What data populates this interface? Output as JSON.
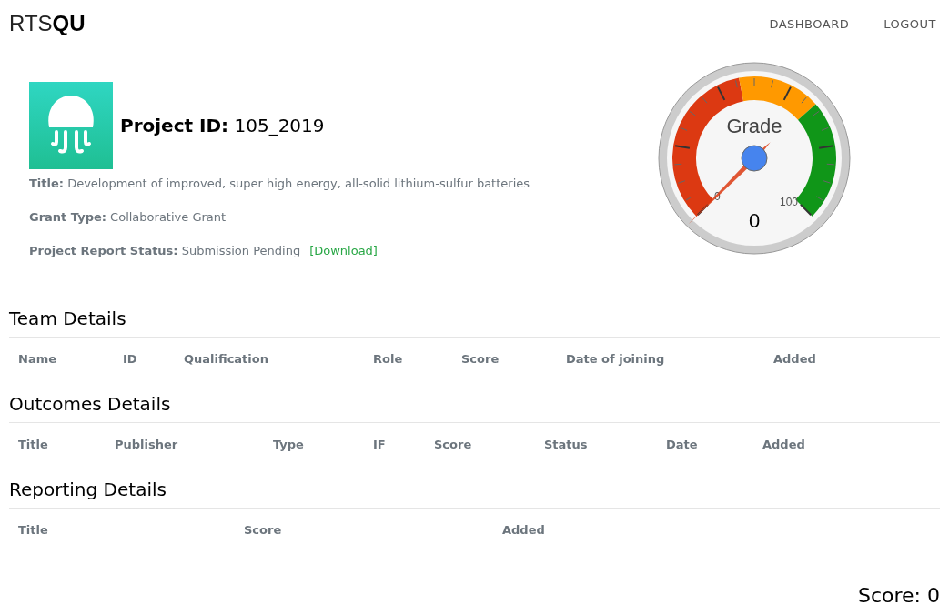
{
  "brand": {
    "light": "RTS",
    "bold": "QU"
  },
  "nav": [
    "DASHBOARD",
    "LOGOUT"
  ],
  "project": {
    "id_label": "Project ID:",
    "id": "105_2019",
    "fields": [
      {
        "label": "Title:",
        "value": "Development of improved, super high energy, all-solid lithium-sulfur batteries"
      },
      {
        "label": "Grant Type:",
        "value": "Collaborative Grant"
      },
      {
        "label": "Project Report Status:",
        "value": "Submission Pending",
        "link": "[Download]"
      }
    ]
  },
  "gauge": {
    "title": "Grade",
    "min": "0",
    "max": "100",
    "reading": "0"
  },
  "sections": [
    {
      "title": "Team Details",
      "columns": [
        "Name",
        "ID",
        "Qualification",
        "Role",
        "Score",
        "Date of joining",
        "Added"
      ]
    },
    {
      "title": "Outcomes Details",
      "columns": [
        "Title",
        "Publisher",
        "Type",
        "IF",
        "Score",
        "Status",
        "Date",
        "Added"
      ]
    },
    {
      "title": "Reporting Details",
      "columns": [
        "Title",
        "Score",
        "Added"
      ]
    }
  ],
  "score": "Score: 0"
}
